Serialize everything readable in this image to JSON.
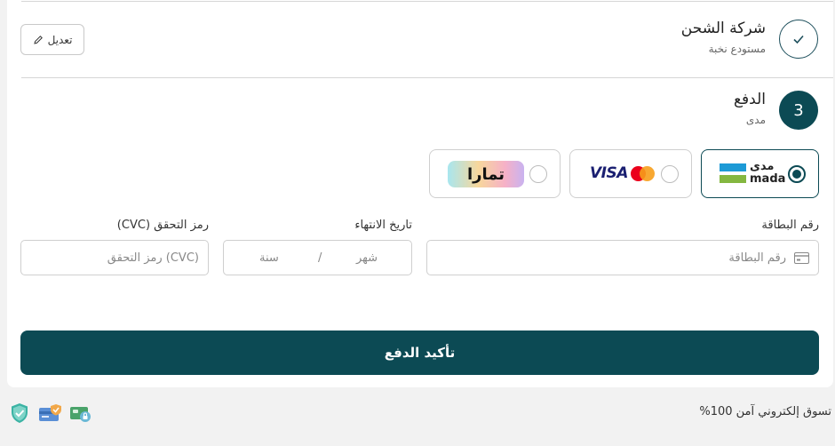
{
  "shipping": {
    "title": "شركة الشحن",
    "subtitle": "مستودع نخبة",
    "edit_label": "تعديل"
  },
  "payment": {
    "step_number": "3",
    "title": "الدفع",
    "subtitle": "مدى",
    "options": [
      {
        "id": "mada",
        "brand_ar": "مدى",
        "brand_en": "mada",
        "selected": true
      },
      {
        "id": "visa-mastercard",
        "brand_visa": "VISA",
        "selected": false
      },
      {
        "id": "tamara",
        "brand_ar": "تمارا",
        "selected": false
      }
    ]
  },
  "form": {
    "card_number_label": "رقم البطاقة",
    "card_number_placeholder": "رقم البطاقة",
    "expiry_label": "تاريخ الانتهاء",
    "expiry_month_placeholder": "شهر",
    "expiry_separator": "/",
    "expiry_year_placeholder": "سنة",
    "cvc_label": "رمز التحقق (CVC)",
    "cvc_placeholder": "(CVC) رمز التحقق"
  },
  "confirm_label": "تأكيد الدفع",
  "footer": {
    "secure_text": "تسوق إلكتروني آمن 100%",
    "trust_icons": [
      "shield-check-icon",
      "secure-card-icon",
      "secure-payment-icon"
    ]
  },
  "colors": {
    "primary": "#0c4a54",
    "mada_blue": "#1d9ad6",
    "mada_green": "#84b740",
    "visa_blue": "#1a1f71",
    "mastercard_red": "#eb001b",
    "mastercard_orange": "#f79e1b"
  }
}
